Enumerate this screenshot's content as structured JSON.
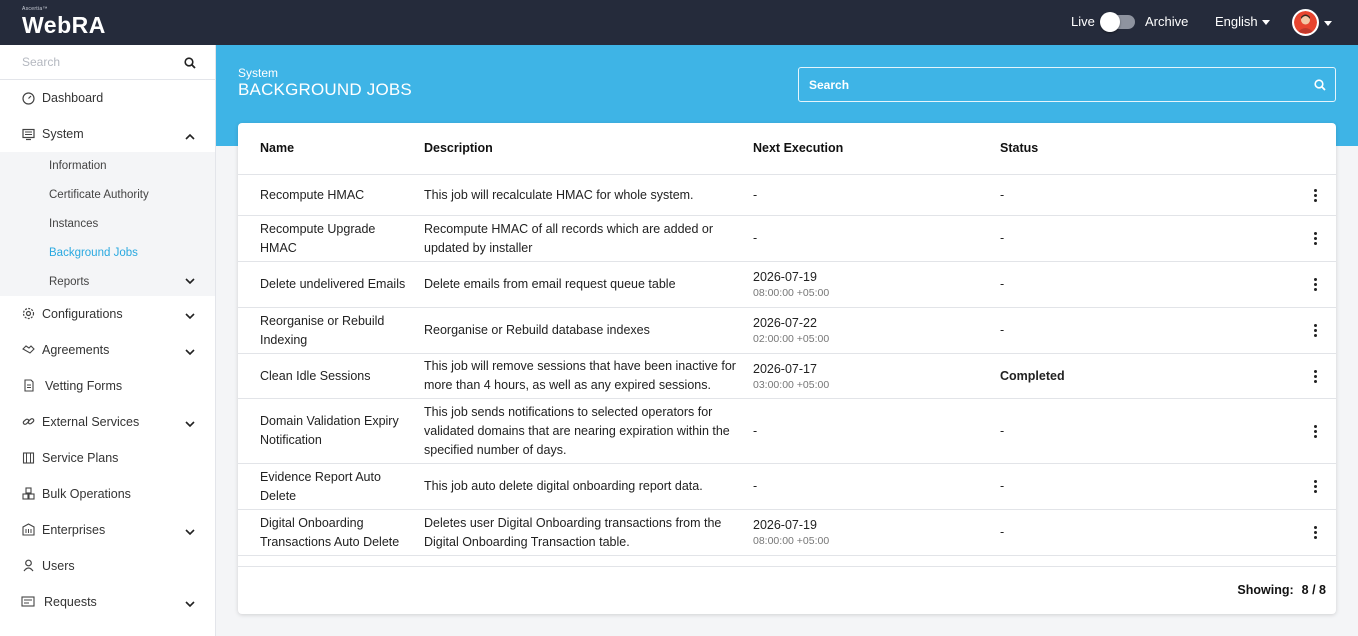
{
  "app": {
    "logo_small": "Ascertia™",
    "logo_name": "WebRA",
    "live_label": "Live",
    "archive_label": "Archive",
    "language": "English"
  },
  "sidebar": {
    "search_placeholder": "Search",
    "items": [
      {
        "label": "Dashboard",
        "icon": "dashboard-icon"
      },
      {
        "label": "System",
        "icon": "system-icon",
        "expanded": true
      },
      {
        "label": "Configurations",
        "icon": "gear-icon"
      },
      {
        "label": "Agreements",
        "icon": "handshake-icon"
      },
      {
        "label": "Vetting Forms",
        "icon": "form-icon"
      },
      {
        "label": "External Services",
        "icon": "link-icon"
      },
      {
        "label": "Service Plans",
        "icon": "plans-icon"
      },
      {
        "label": "Bulk Operations",
        "icon": "bulk-icon"
      },
      {
        "label": "Enterprises",
        "icon": "building-icon"
      },
      {
        "label": "Users",
        "icon": "user-icon"
      },
      {
        "label": "Requests",
        "icon": "requests-icon"
      }
    ],
    "system_sub": [
      {
        "label": "Information"
      },
      {
        "label": "Certificate Authority"
      },
      {
        "label": "Instances"
      },
      {
        "label": "Background Jobs",
        "active": true
      },
      {
        "label": "Reports"
      }
    ]
  },
  "page": {
    "breadcrumb": "System",
    "title": "BACKGROUND JOBS",
    "search_placeholder": "Search"
  },
  "table": {
    "columns": [
      "Name",
      "Description",
      "Next Execution",
      "Status"
    ],
    "rows": [
      {
        "name": "Recompute HMAC",
        "description": "This job will recalculate HMAC for whole system.",
        "next_date": "-",
        "next_time": "",
        "status": "-"
      },
      {
        "name": "Recompute Upgrade HMAC",
        "description": "Recompute HMAC of all records which are added or updated by installer",
        "next_date": "-",
        "next_time": "",
        "status": "-"
      },
      {
        "name": "Delete undelivered Emails",
        "description": "Delete emails from email request queue table",
        "next_date": "2026-07-19",
        "next_time": "08:00:00 +05:00",
        "status": "-"
      },
      {
        "name": "Reorganise or Rebuild Indexing",
        "description": "Reorganise or Rebuild database indexes",
        "next_date": "2026-07-22",
        "next_time": "02:00:00 +05:00",
        "status": "-"
      },
      {
        "name": "Clean Idle Sessions",
        "description": "This job will remove sessions that have been inactive for more than 4 hours, as well as any expired sessions.",
        "next_date": "2026-07-17",
        "next_time": "03:00:00 +05:00",
        "status": "Completed"
      },
      {
        "name": "Domain Validation Expiry Notification",
        "description": "This job sends notifications to selected operators for validated domains that are nearing expiration within the specified number of days.",
        "next_date": "-",
        "next_time": "",
        "status": "-"
      },
      {
        "name": "Evidence Report Auto Delete",
        "description": "This job auto delete digital onboarding report data.",
        "next_date": "-",
        "next_time": "",
        "status": "-"
      },
      {
        "name": "Digital Onboarding Transactions Auto Delete",
        "description": "Deletes user Digital Onboarding transactions from the Digital Onboarding Transaction table.",
        "next_date": "2026-07-19",
        "next_time": "08:00:00 +05:00",
        "status": "-"
      }
    ],
    "showing_label": "Showing:",
    "showing_value": "8 / 8"
  },
  "colors": {
    "topbar": "#252b3b",
    "accent": "#3eb4e6",
    "active_link": "#2aa9e0"
  }
}
